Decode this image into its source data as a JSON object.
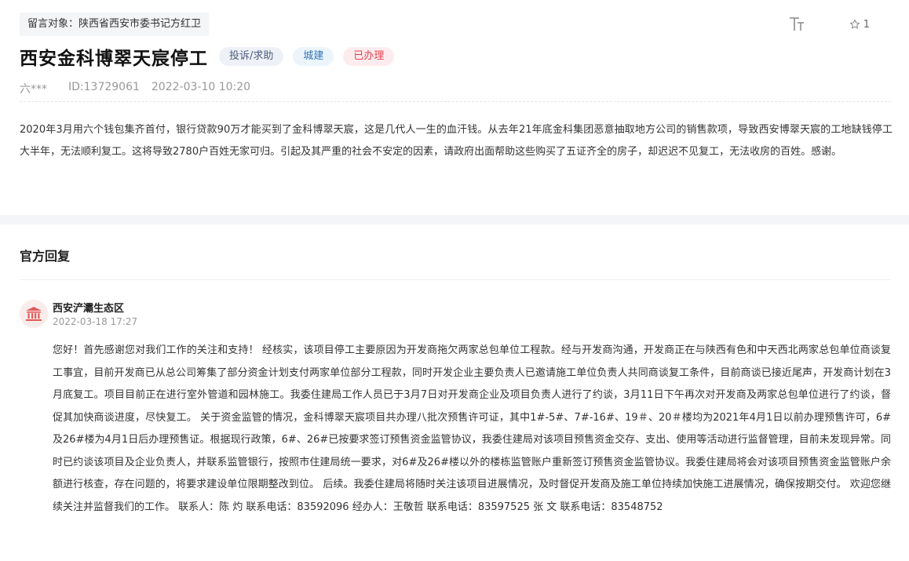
{
  "target": "留言对象：陕西省西安市委书记方红卫",
  "toolbar": {
    "font_icon": "font-size-icon",
    "star_icon": "star-icon",
    "star_count": "1"
  },
  "message": {
    "title": "西安金科博翠天宸停工",
    "tags": {
      "type": "投诉/求助",
      "dept": "城建",
      "status": "已办理"
    },
    "author": "六***",
    "id": "ID:13729061",
    "date": "2022-03-10 10:20",
    "content": "2020年3月用六个钱包集齐首付，银行贷款90万才能买到了金科博翠天宸，这是几代人一生的血汗钱。从去年21年底金科集团恶意抽取地方公司的销售款项，导致西安博翠天宸的工地缺钱停工大半年，无法顺利复工。这将导致2780户百姓无家可归。引起及其严重的社会不安定的因素，请政府出面帮助这些购买了五证齐全的房子，却迟迟不见复工，无法收房的百姓。感谢。"
  },
  "reply_section": {
    "title": "官方回复",
    "department": "西安浐灞生态区",
    "dept_icon": "government-building-icon",
    "time": "2022-03-18 17:27",
    "content": "您好！首先感谢您对我们工作的关注和支持！ 经核实，该项目停工主要原因为开发商拖欠两家总包单位工程款。经与开发商沟通，开发商正在与陕西有色和中天西北两家总包单位商谈复工事宜，目前开发商已从总公司筹集了部分资金计划支付两家单位部分工程款，同时开发企业主要负责人已邀请施工单位负责人共同商谈复工条件，目前商谈已接近尾声，开发商计划在3月底复工。项目目前正在进行室外管道和园林施工。我委住建局工作人员已于3月7日对开发商企业及项目负责人进行了约谈，3月11日下午再次对开发商及两家总包单位进行了约谈，督促其加快商谈进度，尽快复工。 关于资金监管的情况，金科博翠天宸项目共办理八批次预售许可证，其中1#-5#、7#-16#、19＃、20＃楼均为2021年4月1日以前办理预售许可，6#及26#楼为4月1日后办理预售证。根据现行政策，6#、26#已按要求签订预售资金监管协议，我委住建局对该项目预售资金交存、支出、使用等活动进行监督管理，目前未发现异常。同时已约谈该项目及企业负责人，并联系监管银行，按照市住建局统一要求，对6#及26#楼以外的楼栋监管账户重新签订预售资金监管协议。我委住建局将会对该项目预售资金监管账户余额进行核查，存在问题的，将要求建设单位限期整改到位。 后续。我委住建局将随时关注该项目进展情况，及时督促开发商及施工单位持续加快施工进展情况，确保按期交付。 欢迎您继续关注并监督我们的工作。 联系人：陈 灼 联系电话：83592096 经办人：王敬哲 联系电话：83597525 张 文 联系电话：83548752"
  }
}
